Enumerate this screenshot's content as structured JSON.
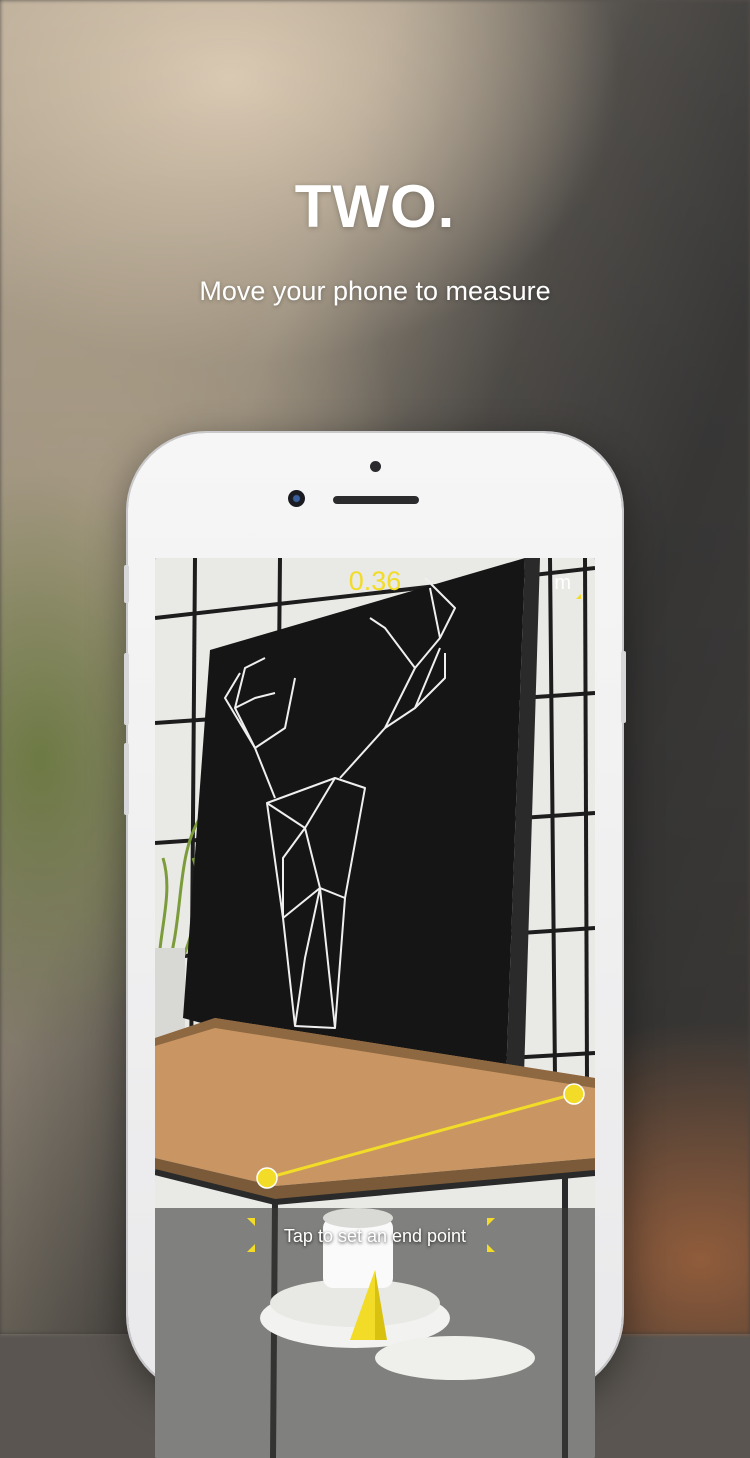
{
  "header": {
    "step_title": "TWO.",
    "instruction": "Move your phone to measure"
  },
  "measurement": {
    "value": "0.36",
    "unit": "m"
  },
  "screen": {
    "hint": "Tap to set an end point"
  },
  "colors": {
    "accent": "#f2dc27",
    "text": "#ffffff"
  },
  "icons": {
    "crosshair": "crosshair-icon",
    "start_marker": "measure-point-icon",
    "end_marker": "measure-point-icon"
  }
}
